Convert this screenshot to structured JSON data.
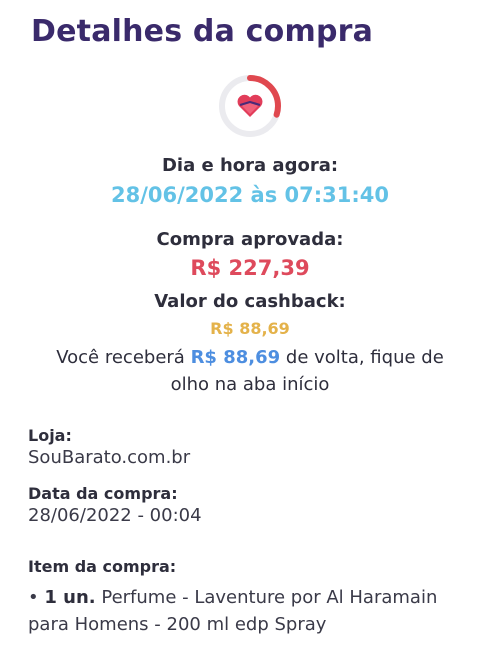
{
  "page": {
    "title": "Detalhes da compra"
  },
  "status": {
    "icon": "heart-icon",
    "ring_color": "#e0484f",
    "progress_fraction": 0.3
  },
  "datetime": {
    "label": "Dia e hora agora:",
    "value": "28/06/2022 às 07:31:40"
  },
  "purchase": {
    "label": "Compra aprovada:",
    "value": "R$ 227,39"
  },
  "cashback": {
    "label": "Valor do cashback:",
    "value": "R$ 88,69",
    "message_prefix": "Você receberá",
    "message_amount": "R$ 88,69",
    "message_suffix": "de volta, fique de olho na aba início"
  },
  "store": {
    "label": "Loja:",
    "value": "SouBarato.com.br"
  },
  "purchase_date": {
    "label": "Data da compra:",
    "value": "28/06/2022 - 00:04"
  },
  "items": {
    "label": "Item da compra:",
    "bullet": "•",
    "list": [
      {
        "quantity": "1 un.",
        "description": "Perfume - Laventure por Al Haramain para Homens - 200 ml edp Spray"
      }
    ]
  },
  "colors": {
    "title": "#3a2a6b",
    "datetime": "#63c2e6",
    "price": "#de4a5c",
    "cashback": "#e4b24a",
    "highlight": "#4d8ee0"
  }
}
